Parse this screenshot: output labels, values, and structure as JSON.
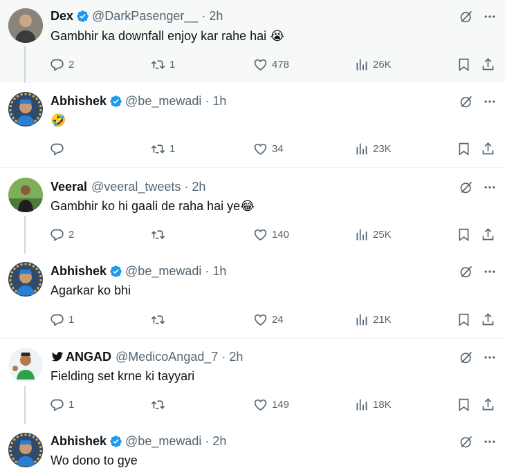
{
  "tweets": [
    {
      "name": "Dex",
      "verified": true,
      "handle": "@DarkPasenger__",
      "time": "2h",
      "text": "Gambhir ka downfall enjoy kar rahe hai",
      "emoji": "😭",
      "replies": "2",
      "retweets": "1",
      "likes": "478",
      "views": "26K"
    },
    {
      "name": "Abhishek",
      "verified": true,
      "handle": "@be_mewadi",
      "time": "1h",
      "text": "",
      "emoji": "🤣",
      "replies": "",
      "retweets": "1",
      "likes": "34",
      "views": "23K"
    },
    {
      "name": "Veeral",
      "verified": false,
      "handle": "@veeral_tweets",
      "time": "2h",
      "text": "Gambhir ko hi gaali de raha hai ye",
      "emoji": "😂",
      "replies": "2",
      "retweets": "",
      "likes": "140",
      "views": "25K"
    },
    {
      "name": "Abhishek",
      "verified": true,
      "handle": "@be_mewadi",
      "time": "1h",
      "text": "Agarkar ko bhi",
      "emoji": "",
      "replies": "1",
      "retweets": "",
      "likes": "24",
      "views": "21K"
    },
    {
      "name": "ANGAD",
      "verified": false,
      "handle": "@MedicoAngad_7",
      "time": "2h",
      "text": "Fielding set krne ki tayyari",
      "emoji": "",
      "replies": "1",
      "retweets": "",
      "likes": "149",
      "views": "18K"
    },
    {
      "name": "Abhishek",
      "verified": true,
      "handle": "@be_mewadi",
      "time": "2h",
      "text": "Wo dono to gye",
      "emoji": "",
      "replies": "",
      "retweets": "",
      "likes": "",
      "views": ""
    }
  ],
  "separator": "·",
  "colors": {
    "accent": "#1d9bf0",
    "text": "#0f1419",
    "muted": "#536471",
    "highlight": "#f7f9f9"
  }
}
